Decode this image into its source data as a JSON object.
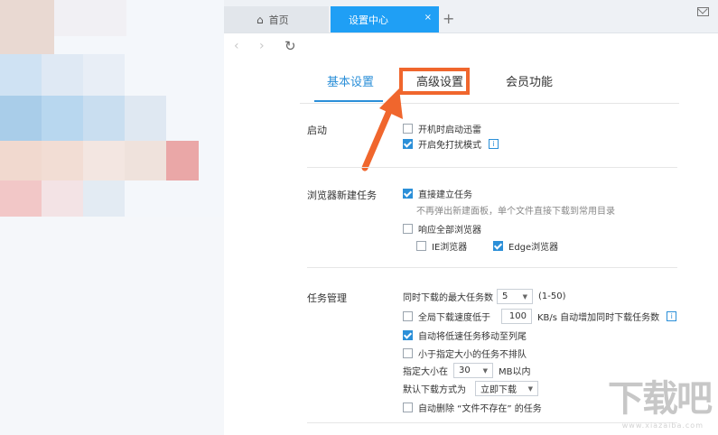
{
  "tabs": {
    "home": {
      "label": "首页",
      "icon": "home-icon"
    },
    "settings": {
      "label": "设置中心",
      "close": "×"
    },
    "add": "+"
  },
  "nav": {
    "back": "‹",
    "forward": "›",
    "reload": "↻"
  },
  "subtabs": {
    "basic": "基本设置",
    "advanced": "高级设置",
    "member": "会员功能"
  },
  "annotation": {
    "color": "#f0662d"
  },
  "sections": {
    "startup": {
      "label": "启动",
      "options": [
        {
          "label": "开机时启动迅雷",
          "checked": false
        },
        {
          "label": "开启免打扰模式",
          "checked": true,
          "info": "i"
        }
      ]
    },
    "browser": {
      "label": "浏览器新建任务",
      "direct": {
        "label": "直接建立任务",
        "checked": true
      },
      "direct_hint": "不再弹出新建面板，单个文件直接下载到常用目录",
      "all": {
        "label": "响应全部浏览器",
        "checked": false
      },
      "ie": {
        "label": "IE浏览器",
        "checked": false
      },
      "edge": {
        "label": "Edge浏览器",
        "checked": true
      }
    },
    "tasks": {
      "label": "任务管理",
      "max_label": "同时下载的最大任务数",
      "max_value": "5",
      "max_range": "(1-50)",
      "speed_prefix": "全局下载速度低于",
      "speed_value": "100",
      "speed_suffix": "KB/s 自动增加同时下载任务数",
      "speed_checked": false,
      "move_slow": {
        "label": "自动将低速任务移动至列尾",
        "checked": true
      },
      "small_nq": {
        "label": "小于指定大小的任务不排队",
        "checked": false
      },
      "size_prefix": "指定大小在",
      "size_value": "30",
      "size_suffix": "MB以内",
      "mode_label": "默认下载方式为",
      "mode_value": "立即下载",
      "auto_delete": {
        "label": "自动删除 “文件不存在” 的任务",
        "checked": false
      }
    }
  },
  "watermark": {
    "text": "下载吧",
    "sub": "www.xiazaiba.com"
  },
  "colors": {
    "accent": "#2b8fd8",
    "tab_active": "#1f9ff5",
    "highlight": "#f0662d"
  }
}
